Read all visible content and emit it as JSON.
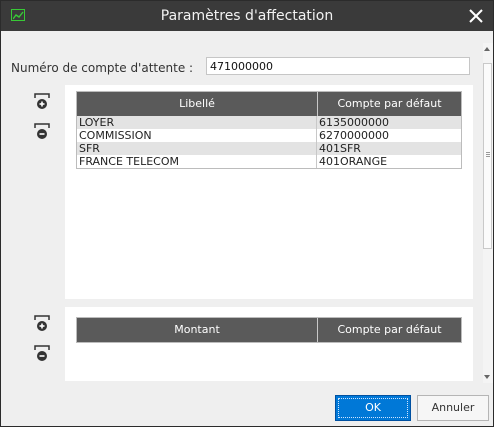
{
  "window": {
    "title": "Paramètres d'affectation",
    "icons": {
      "app": "chart-icon",
      "close": "close-icon"
    }
  },
  "account": {
    "label": "Numéro de compte d'attente :",
    "value": "471000000"
  },
  "table1": {
    "headers": [
      "Libellé",
      "Compte par défaut"
    ],
    "rows": [
      [
        "LOYER",
        "6135000000"
      ],
      [
        "COMMISSION",
        "6270000000"
      ],
      [
        "SFR",
        "401SFR"
      ],
      [
        "FRANCE TELECOM",
        "401ORANGE"
      ]
    ]
  },
  "table2": {
    "headers": [
      "Montant",
      "Compte par défaut"
    ],
    "rows": []
  },
  "side_icons": {
    "add": "add-row-icon",
    "remove": "remove-row-icon"
  },
  "buttons": {
    "ok": "OK",
    "cancel": "Annuler"
  },
  "colors": {
    "titlebar": "#3a3a3a",
    "grid_header": "#5a5a5a",
    "primary": "#0078d7",
    "alt_row": "#e3e3e3"
  }
}
